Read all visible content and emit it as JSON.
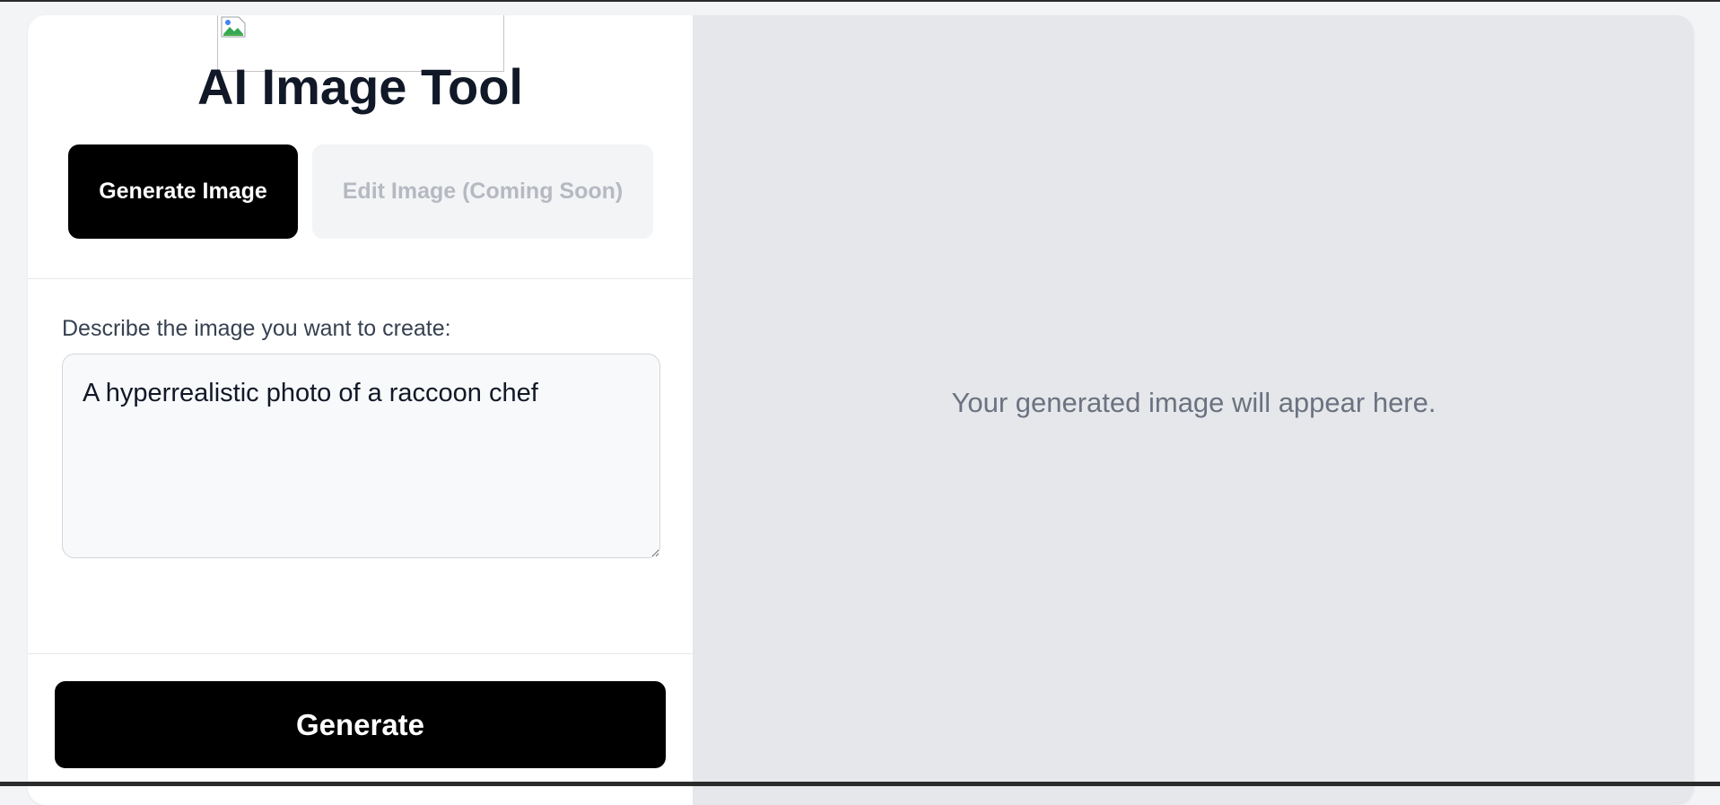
{
  "app": {
    "title": "AI Image Tool",
    "logo_icon": "broken-image-icon"
  },
  "tabs": {
    "generate_label": "Generate Image",
    "edit_label": "Edit Image (Coming Soon)"
  },
  "prompt": {
    "label": "Describe the image you want to create:",
    "value": "A hyperrealistic photo of a raccoon chef"
  },
  "actions": {
    "generate_label": "Generate"
  },
  "preview": {
    "placeholder": "Your generated image will appear here."
  },
  "colors": {
    "primary": "#000000",
    "disabled_text": "#b6b9c1",
    "preview_background": "#e5e7eb"
  }
}
